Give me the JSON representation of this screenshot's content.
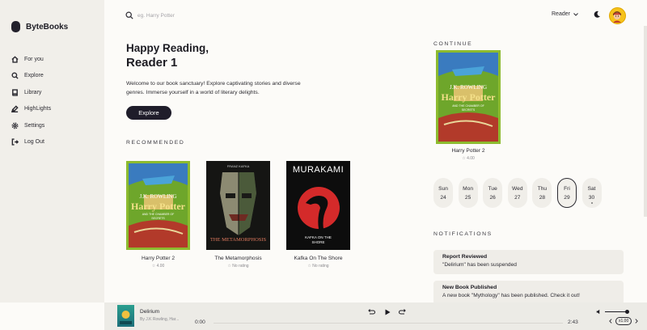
{
  "sidebar": {
    "brand": "ByteBooks",
    "items": [
      {
        "label": "For you",
        "icon": "home-icon"
      },
      {
        "label": "Explore",
        "icon": "search-icon"
      },
      {
        "label": "Library",
        "icon": "book-icon"
      },
      {
        "label": "HighLights",
        "icon": "highlighter-icon"
      },
      {
        "label": "Settings",
        "icon": "gear-icon"
      },
      {
        "label": "Log Out",
        "icon": "logout-icon"
      }
    ]
  },
  "header": {
    "search_placeholder": "eg. Harry Potter",
    "role": "Reader"
  },
  "hero": {
    "greeting": "Happy Reading,",
    "name": "Reader 1",
    "intro": "Welcome to our book sanctuary! Explore captivating stories and diverse genres. Immerse yourself in a world of literary delights.",
    "button": "Explore"
  },
  "recommended": {
    "title": "RECOMMENDED",
    "books": [
      {
        "title": "Harry Potter 2",
        "meta": "4.00"
      },
      {
        "title": "The Metamorphosis",
        "meta": "No rating"
      },
      {
        "title": "Kafka On The Shore",
        "meta": "No rating"
      }
    ]
  },
  "covers": {
    "hp_author": "J.K. ROWLING",
    "hp_title": "Harry Potter",
    "hp_sub": "AND THE CHAMBER OF SECRETS",
    "meta_author": "FRANZ KAFKA",
    "meta_title": "THE METAMORPHOSIS",
    "kafka_author": "MURAKAMI",
    "kafka_title": "KAFKA ON THE SHORE"
  },
  "continue": {
    "title": "CONTINUE",
    "book": {
      "title": "Harry Potter 2",
      "meta": "4.00"
    }
  },
  "days": [
    {
      "name": "Sun",
      "date": "24"
    },
    {
      "name": "Mon",
      "date": "25"
    },
    {
      "name": "Tue",
      "date": "26"
    },
    {
      "name": "Wed",
      "date": "27"
    },
    {
      "name": "Thu",
      "date": "28"
    },
    {
      "name": "Fri",
      "date": "29"
    },
    {
      "name": "Sat",
      "date": "30"
    }
  ],
  "notifications": {
    "title": "NOTIFICATIONS",
    "items": [
      {
        "heading": "Report Reviewed",
        "body": "\"Delirium\" has been suspended"
      },
      {
        "heading": "New Book Published",
        "body": "A new book \"Mythology\" has been published. Check it out!"
      }
    ]
  },
  "player": {
    "title": "Delirium",
    "author": "By J.K Rowling, Har...",
    "current_time": "0:00",
    "total_time": "2:43",
    "progress": 0,
    "volume": 1,
    "speed": "x1.00"
  },
  "colors": {
    "accent": "#1f1d2a",
    "sidebar_bg": "#f1efea",
    "page_bg": "#fcfbf8"
  }
}
